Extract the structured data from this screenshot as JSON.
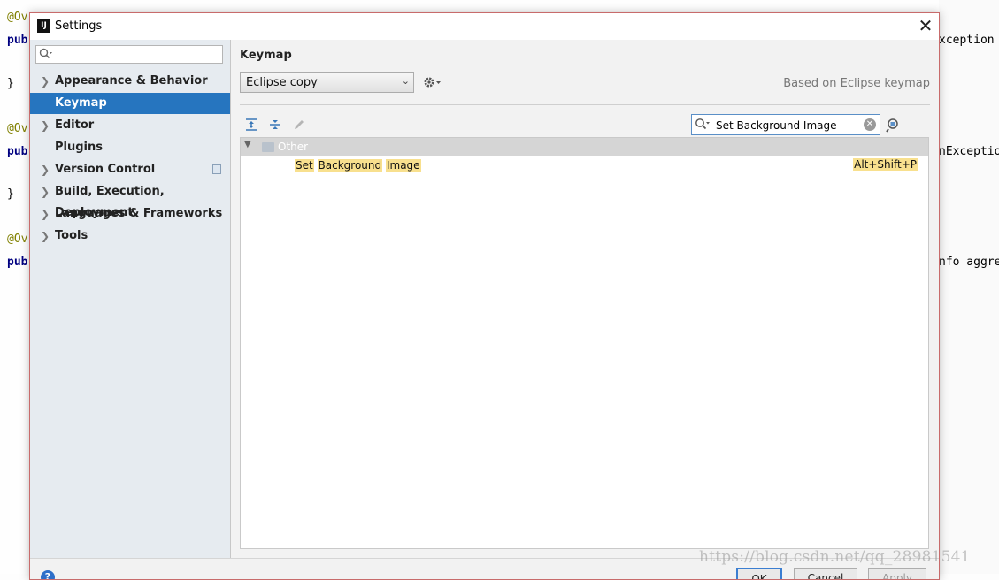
{
  "editor": {
    "lines": [
      {
        "left": "@Ov",
        "right": ""
      },
      {
        "left": "pub",
        "right": "xception"
      },
      {
        "left": "}",
        "right": ""
      },
      {
        "left": "@Ov",
        "right": ""
      },
      {
        "left": "pub",
        "right": "nExceptio"
      },
      {
        "left": "}",
        "right": ""
      },
      {
        "left": "@Ov",
        "right": ""
      },
      {
        "left": "pub",
        "right": "nfo aggreg"
      }
    ]
  },
  "watermark": "https://blog.csdn.net/qq_28981541",
  "dialog": {
    "title": "Settings",
    "app_icon_text": "IJ",
    "close_glyph": "✕"
  },
  "sidebar": {
    "search_placeholder": "",
    "items": [
      {
        "label": "Appearance & Behavior",
        "expandable": true,
        "selected": false
      },
      {
        "label": "Keymap",
        "expandable": false,
        "selected": true
      },
      {
        "label": "Editor",
        "expandable": true,
        "selected": false
      },
      {
        "label": "Plugins",
        "expandable": false,
        "selected": false
      },
      {
        "label": "Version Control",
        "expandable": true,
        "selected": false
      },
      {
        "label": "Build, Execution, Deployment",
        "expandable": true,
        "selected": false
      },
      {
        "label": "Languages & Frameworks",
        "expandable": true,
        "selected": false
      },
      {
        "label": "Tools",
        "expandable": true,
        "selected": false
      }
    ]
  },
  "keymap": {
    "title": "Keymap",
    "selected_keymap": "Eclipse copy",
    "based_on": "Based on Eclipse keymap",
    "filter_value": "Set Background Image",
    "tree": {
      "group_label": "Other",
      "action_words": [
        "Set",
        "Background",
        "Image"
      ],
      "shortcut": "Alt+Shift+P"
    }
  },
  "buttons": {
    "ok": "OK",
    "cancel": "Cancel",
    "apply": "Apply",
    "help": "?"
  },
  "colors": {
    "selection": "#2675bf",
    "highlight": "#f8e08e",
    "sidebar_bg": "#e6ebf0"
  }
}
